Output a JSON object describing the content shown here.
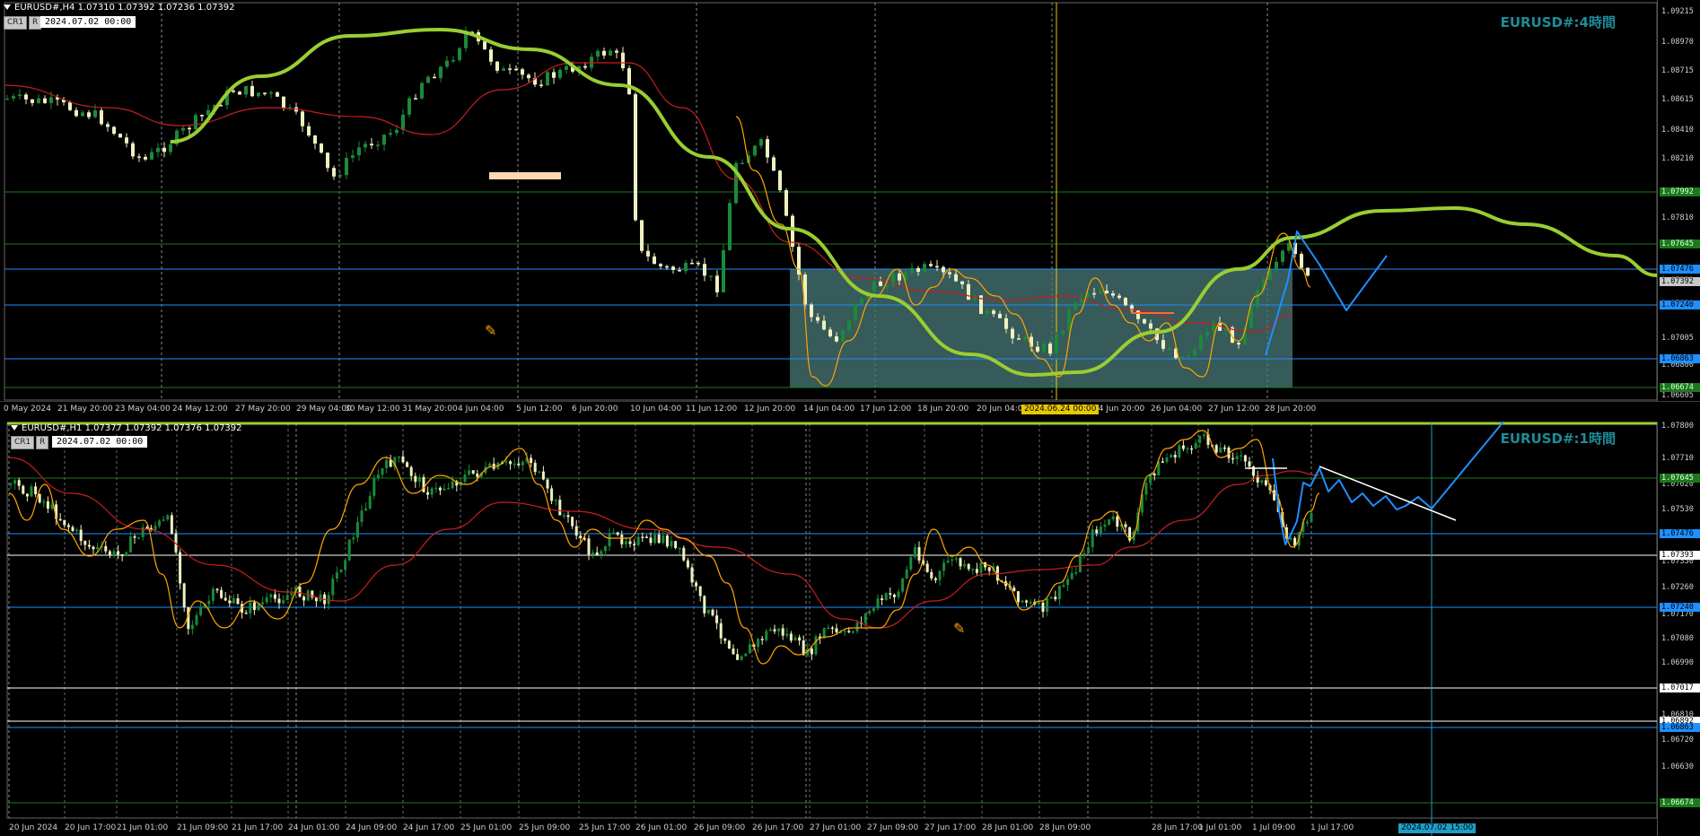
{
  "top_chart": {
    "header": "EURUSD#,H4  1.07310 1.07392 1.07236 1.07392",
    "btn_cr1": "CR1",
    "btn_r": "R",
    "datetime_box": "2024.07.02  00:00",
    "title": "EURUSD#:4時間",
    "price_labels": [
      "1.09215",
      "1.08970",
      "1.08715",
      "1.08615",
      "1.08410",
      "1.08210",
      "1.07810",
      "1.07610",
      "1.07392",
      "1.07210",
      "1.07005",
      "1.06800",
      "1.06605"
    ],
    "badges": [
      {
        "text": "1.07992",
        "bg": "#1a7a1a",
        "fg": "#e0ffe0"
      },
      {
        "text": "1.07645",
        "bg": "#1a7a1a",
        "fg": "#e0ffe0"
      },
      {
        "text": "1.07476",
        "bg": "#1e90ff",
        "fg": "#000000"
      },
      {
        "text": "1.07392",
        "bg": "#c8c8c8",
        "fg": "#000000"
      },
      {
        "text": "1.07240",
        "bg": "#1e90ff",
        "fg": "#000000"
      },
      {
        "text": "1.06863",
        "bg": "#1e90ff",
        "fg": "#000000"
      },
      {
        "text": "1.06674",
        "bg": "#1a7a1a",
        "fg": "#e0ffe0"
      }
    ],
    "time_labels": [
      "0 May 2024",
      "21 May 20:00",
      "23 May 04:00",
      "24 May 12:00",
      "27 May 20:00",
      "29 May 04:00",
      "30 May 12:00",
      "31 May 20:00",
      "4 Jun 04:00",
      "5 Jun 12:00",
      "6 Jun 20:00",
      "10 Jun 04:00",
      "11 Jun 12:00",
      "12 Jun 20:00",
      "14 Jun 04:00",
      "17 Jun 12:00",
      "18 Jun 20:00",
      "20 Jun 04:00",
      "24 Jun 20:00",
      "26 Jun 04:00",
      "27 Jun 12:00",
      "28 Jun 20:00"
    ],
    "cursor_time": "2024.06.24 00:00"
  },
  "bottom_chart": {
    "header": "EURUSD#,H1  1.07377 1.07392 1.07376 1.07392",
    "btn_cr1": "CR1",
    "btn_r": "R",
    "datetime_box": "2024.07.02  00:00",
    "title": "EURUSD#:1時間",
    "price_labels": [
      "1.07800",
      "1.07710",
      "1.07620",
      "1.07530",
      "1.07440",
      "1.07350",
      "1.07260",
      "1.07170",
      "1.07080",
      "1.06990",
      "1.06900",
      "1.06810",
      "1.06720",
      "1.06630"
    ],
    "badges": [
      {
        "text": "1.07645",
        "bg": "#1a7a1a",
        "fg": "#e0ffe0"
      },
      {
        "text": "1.07476",
        "bg": "#1e90ff",
        "fg": "#000000"
      },
      {
        "text": "1.07393",
        "bg": "#ffffff",
        "fg": "#000000"
      },
      {
        "text": "1.07240",
        "bg": "#1e90ff",
        "fg": "#000000"
      },
      {
        "text": "1.07017",
        "bg": "#ffffff",
        "fg": "#000000"
      },
      {
        "text": "1.06892",
        "bg": "#ffffff",
        "fg": "#000000"
      },
      {
        "text": "1.06863",
        "bg": "#1e90ff",
        "fg": "#000000"
      },
      {
        "text": "1.06674",
        "bg": "#1a7a1a",
        "fg": "#e0ffe0"
      }
    ],
    "time_labels": [
      "20 Jun 2024",
      "20 Jun 17:00",
      "21 Jun 01:00",
      "21 Jun 09:00",
      "21 Jun 17:00",
      "24 Jun 01:00",
      "24 Jun 09:00",
      "24 Jun 17:00",
      "25 Jun 01:00",
      "25 Jun 09:00",
      "25 Jun 17:00",
      "26 Jun 01:00",
      "26 Jun 09:00",
      "26 Jun 17:00",
      "27 Jun 01:00",
      "27 Jun 09:00",
      "27 Jun 17:00",
      "28 Jun 01:00",
      "28 Jun 09:00",
      "28 Jun 17:00",
      "1 Jul 01:00",
      "1 Jul 09:00",
      "1 Jul 17:00"
    ],
    "cursor_time": "2024.07.02 15:00"
  },
  "colors": {
    "bull": "#1a8a3a",
    "bear": "#f0f0c0",
    "ma_red": "#c81e1e",
    "ma_green": "#9acd32",
    "hline_blue": "#1e90ff",
    "hline_green": "#1a7a1a",
    "orange": "#ffa500",
    "box": "#4a7878"
  }
}
